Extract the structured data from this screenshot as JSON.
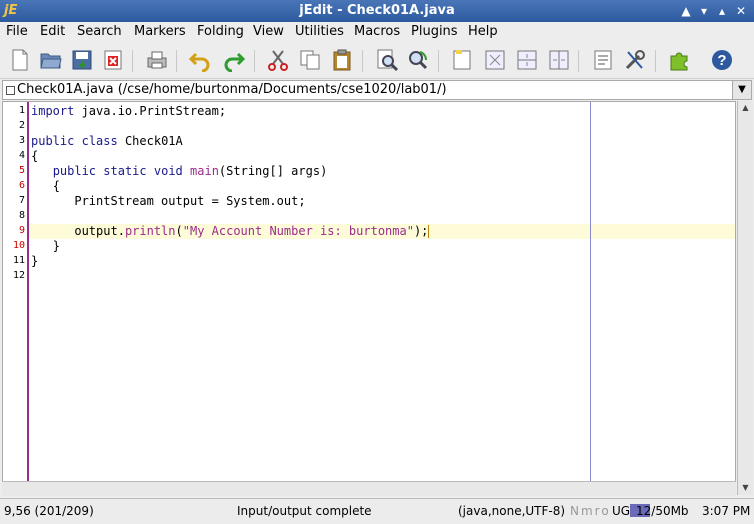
{
  "window": {
    "title": "jEdit - Check01A.java"
  },
  "menu": [
    "File",
    "Edit",
    "Search",
    "Markers",
    "Folding",
    "View",
    "Utilities",
    "Macros",
    "Plugins",
    "Help"
  ],
  "buffer": {
    "label": "Check01A.java (/cse/home/burtonma/Documents/cse1020/lab01/)"
  },
  "line_numbers": [
    "1",
    "2",
    "3",
    "4",
    "5",
    "6",
    "7",
    "8",
    "9",
    "10",
    "11",
    "12"
  ],
  "code": {
    "l1_kw": "import",
    "l1_rest": " java.io.PrintStream;",
    "l3_kw1": "public",
    "l3_kw2": "class",
    "l3_rest": " Check01A",
    "l4": "{",
    "l5_kw1": "public",
    "l5_kw2": "static",
    "l5_kw3": "void",
    "l5_fn": "main",
    "l5_rest": "(String[] args)",
    "l6": "{",
    "l7": "PrintStream output = System.out;",
    "l9_obj": "output.",
    "l9_fn": "println",
    "l9_open": "(",
    "l9_str": "\"My Account Number is: burtonma\"",
    "l9_close": ");",
    "l10": "}",
    "l11": "}"
  },
  "status": {
    "position": "9,56 (201/209)",
    "message": "Input/output complete",
    "mode": "(java,none,UTF-8)",
    "flags": "Nmro",
    "ug": "UG",
    "memory": "12/50Mb",
    "time": "3:07 PM"
  },
  "colors": {
    "keyword": "#1a1a8c",
    "function": "#9b2d8a",
    "string": "#9b2d8a",
    "current_line": "#fdfbd8",
    "gutter_border": "#9b2d8a"
  }
}
